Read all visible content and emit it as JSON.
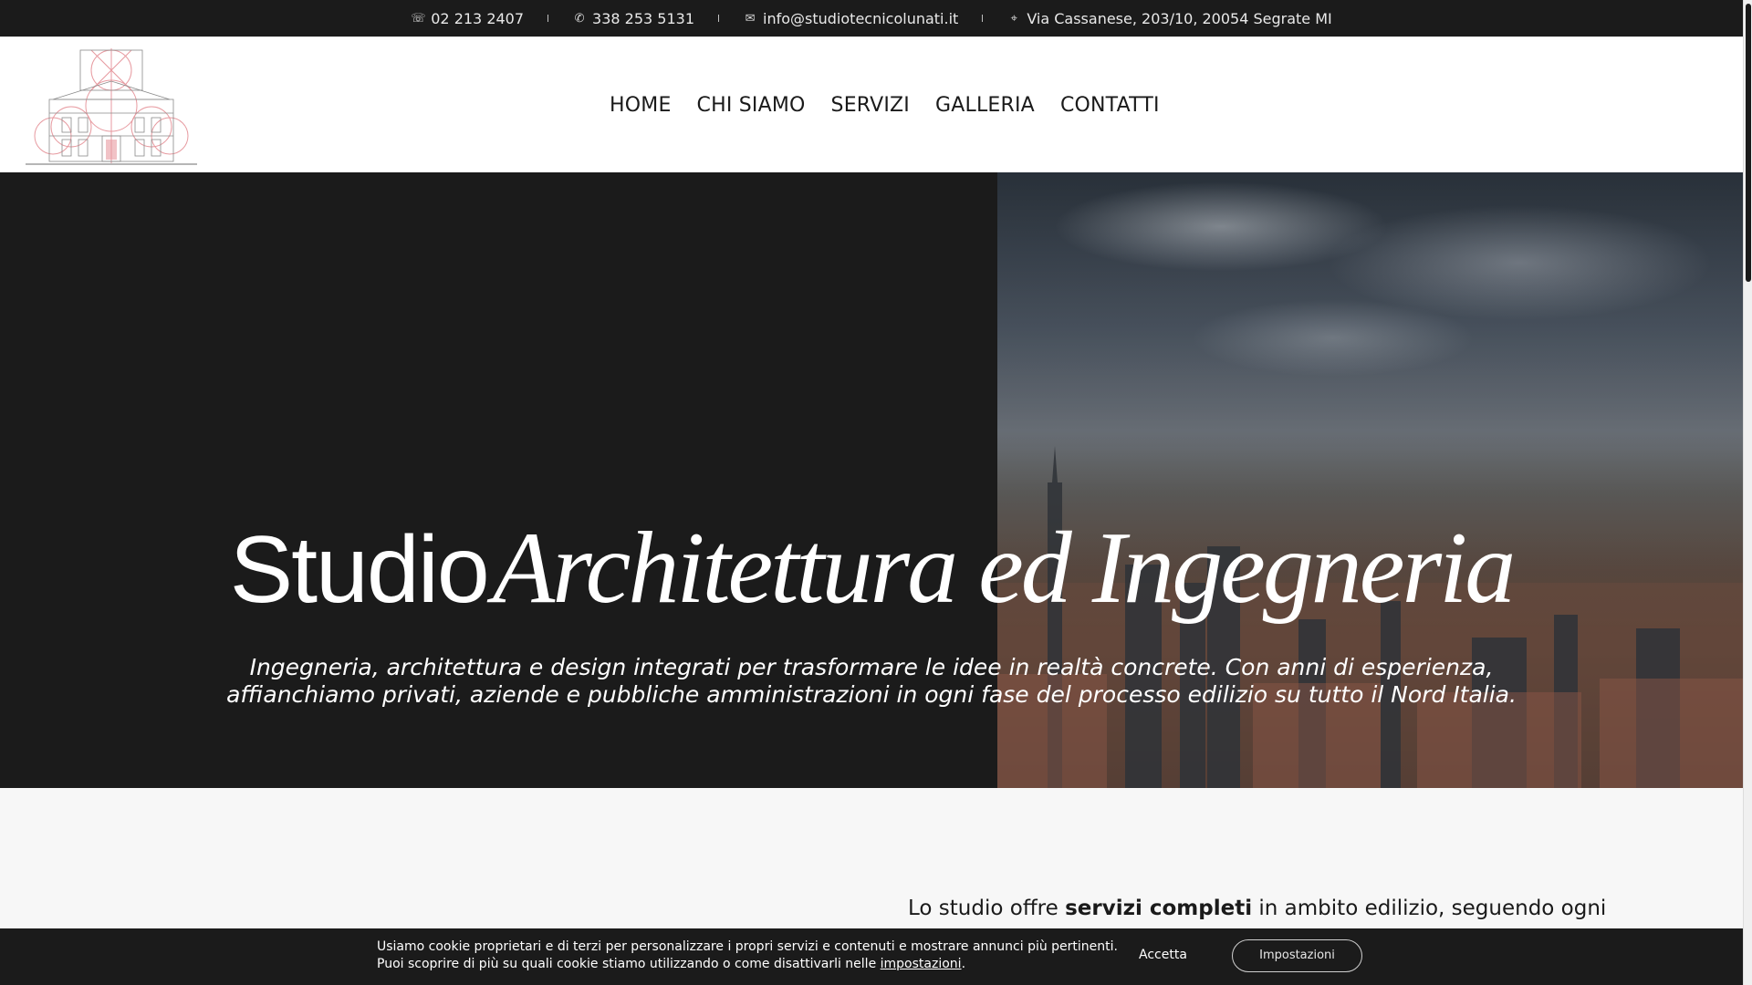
{
  "topbar": {
    "phone": "02 213 2407",
    "mobile": "338 253 5131",
    "email": "info@studiotecnicolunati.it",
    "address": "Via Cassanese, 203/10, 20054 Segrate MI",
    "icons": [
      "phone-icon",
      "mobile-phone-icon",
      "mail-icon",
      "map-pin-icon"
    ]
  },
  "nav": {
    "items": [
      "HOME",
      "CHI SIAMO",
      "SERVIZI",
      "GALLERIA",
      "CONTATTI"
    ]
  },
  "hero": {
    "title_plain": "Studio",
    "title_italic": "Architettura ed Ingegneria",
    "subtitle_line1": "Ingegneria, architettura e design integrati per trasformare le idee in realtà concrete. Con anni di esperienza,",
    "subtitle_line2": "affianchiamo privati, aziende e pubbliche amministrazioni in ogni fase del processo edilizio su tutto il Nord Italia."
  },
  "intro": {
    "part1": "Lo studio offre ",
    "bold": "servizi completi",
    "part2": " in ambito edilizio, seguendo ogni"
  },
  "cookie": {
    "line1": "Usiamo cookie proprietari e di terzi per personalizzare i propri servizi e contenuti e mostrare annunci più pertinenti.",
    "line2": "Puoi scoprire di più su quali cookie stiamo utilizzando o come disattivarli nelle ",
    "link": "impostazioni",
    "line2_end": ".",
    "accept": "Accetta",
    "settings": "Impostazioni"
  },
  "colors": {
    "dark": "#1b1b1b",
    "white": "#ffffff",
    "logo_accent": "#e79aa0"
  }
}
